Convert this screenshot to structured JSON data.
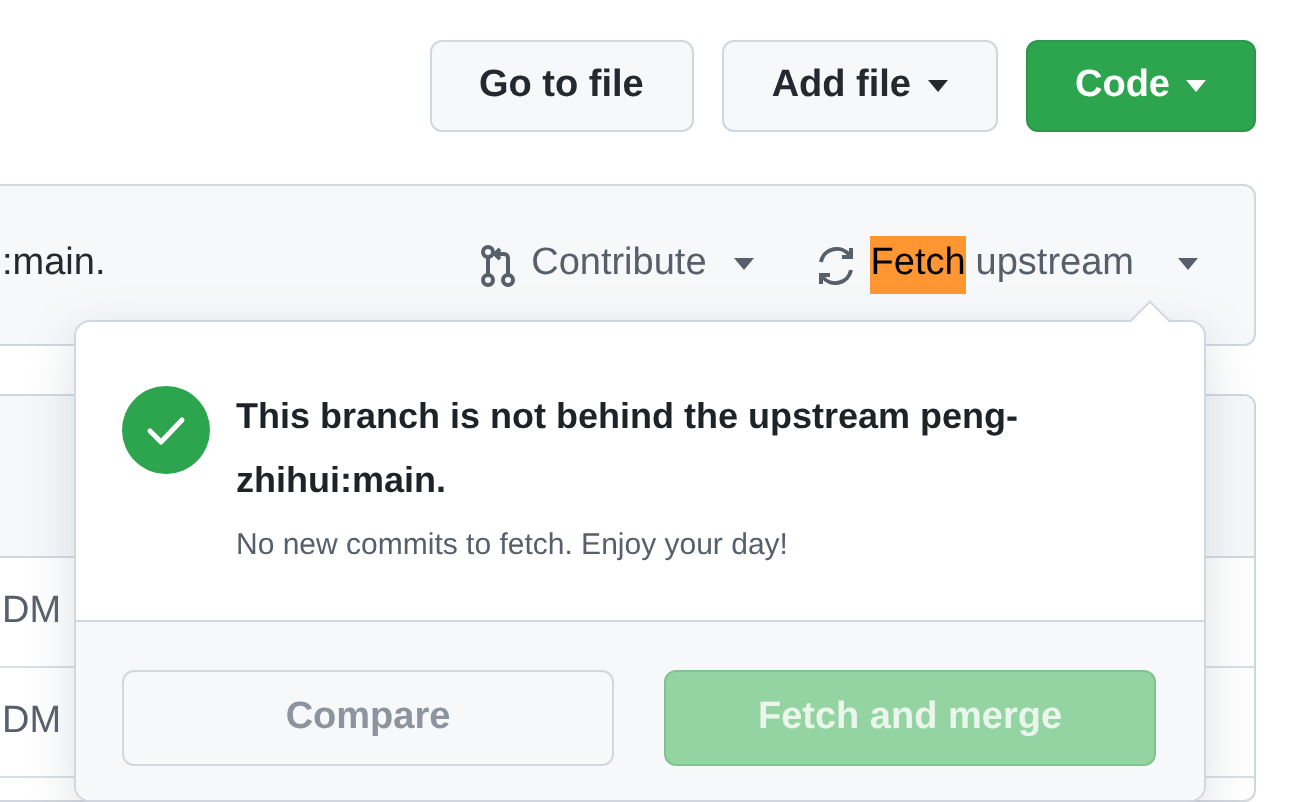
{
  "top_buttons": [
    {
      "label": "Go to file",
      "kind": "plain",
      "caret": false
    },
    {
      "label": "Add file",
      "kind": "plain",
      "caret": true
    },
    {
      "label": "Code",
      "kind": "primary",
      "caret": true
    }
  ],
  "sync_bar": {
    "status_text": ":main.",
    "contribute": {
      "label": "Contribute"
    },
    "fetch": {
      "parts": [
        {
          "text": "Fetch",
          "highlighted": true
        },
        {
          "text": "upstream",
          "highlighted": false
        }
      ]
    }
  },
  "file_rows": [
    {
      "name": "DM"
    },
    {
      "name": "DM"
    }
  ],
  "popover": {
    "title": "This branch is not behind the upstream peng-zhihui:main.",
    "subtitle": "No new commits to fetch. Enjoy your day!",
    "buttons": [
      {
        "label": "Compare",
        "kind": "plain",
        "disabled": true
      },
      {
        "label": "Fetch and merge",
        "kind": "primary",
        "disabled": true
      }
    ]
  }
}
